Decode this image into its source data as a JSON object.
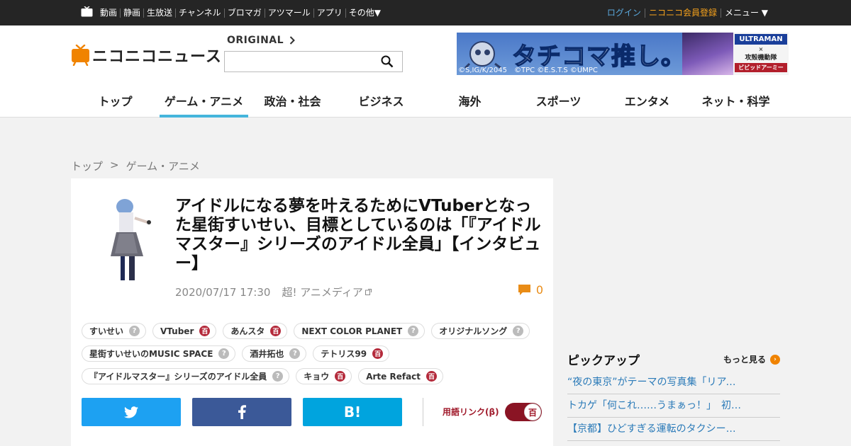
{
  "topbar": {
    "links": [
      "動画",
      "静画",
      "生放送",
      "チャンネル",
      "ブロマガ",
      "アツマール",
      "アプリ",
      "その他▼"
    ],
    "login": "ログイン",
    "register": "ニコニコ会員登録",
    "menu": "メニュー ▼"
  },
  "header": {
    "logo_text": "ニコニコニュース",
    "original_label": "ORIGINAL",
    "search_value": "",
    "banner": {
      "title": "タチコマ推し。",
      "copyright": "©S,IG/K/2045　©TPC ©E.S.T.S ©UMPC",
      "brand_top": "ULTRAMAN",
      "brand_x": "×",
      "brand_mid": "攻殻機動隊",
      "brand_bottom": "ビビッドアーミー"
    }
  },
  "nav": [
    "トップ",
    "ゲーム・アニメ",
    "政治・社会",
    "ビジネス",
    "海外",
    "スポーツ",
    "エンタメ",
    "ネット・科学"
  ],
  "nav_active": "ゲーム・アニメ",
  "breadcrumb": {
    "home": "トップ",
    "sep": ">",
    "current": "ゲーム・アニメ"
  },
  "article": {
    "title": "アイドルになる夢を叶えるためにVTuberとなった星街すいせい、目標としているのは「『アイドルマスター』シリーズのアイドル全員」【インタビュー】",
    "date": "2020/07/17 17:30",
    "source": "超! アニメディア",
    "comment_count": "0"
  },
  "tags": [
    {
      "label": "すいせい",
      "kind": "q"
    },
    {
      "label": "VTuber",
      "kind": "d"
    },
    {
      "label": "あんスタ",
      "kind": "d"
    },
    {
      "label": "NEXT COLOR PLANET",
      "kind": "q"
    },
    {
      "label": "オリジナルソング",
      "kind": "q"
    },
    {
      "label": "星街すいせいのMUSIC SPACE",
      "kind": "q"
    },
    {
      "label": "酒井拓也",
      "kind": "q"
    },
    {
      "label": "テトリス99",
      "kind": "d"
    },
    {
      "label": "『アイドルマスター』シリーズのアイドル全員",
      "kind": "q"
    },
    {
      "label": "キョウ",
      "kind": "d"
    },
    {
      "label": "Arte Refact",
      "kind": "d"
    }
  ],
  "tag_icons": {
    "q": "?",
    "d": "百"
  },
  "share": {
    "hatena_label": "B!"
  },
  "term_link": {
    "label": "用語リンク(β)",
    "toggle_glyph": "百",
    "enabled": true
  },
  "pickup": {
    "title": "ピックアップ",
    "more": "もっと見る",
    "more_glyph": "›",
    "items": [
      "“夜の東京”がテーマの写真集「リアムの写真集」",
      "トカゲ「何これ……うまぁっ！」　初トマト",
      "【京都】ひどすぎる運転のタクシードライバー"
    ]
  },
  "colors": {
    "accent": "#45b5dc",
    "topbar": "#252525",
    "login": "#5aa8dc",
    "register": "#f6a21c",
    "twitter": "#1da1f2",
    "facebook": "#3b5998",
    "hatena": "#00a4de",
    "dic": "#b42a3b",
    "comment": "#e98c16"
  }
}
